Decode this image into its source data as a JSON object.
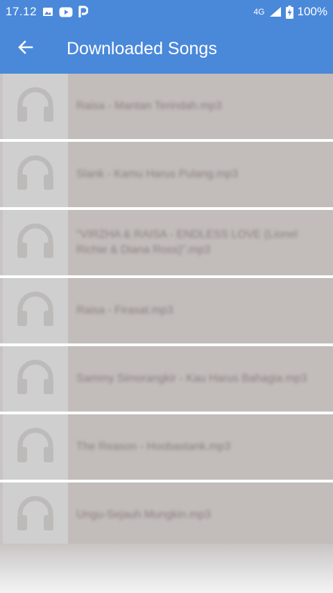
{
  "status_bar": {
    "time": "17.12",
    "network": "4G",
    "battery": "100%",
    "icons": [
      "image-icon",
      "youtube-icon",
      "p-app-icon",
      "signal-icon",
      "battery-charging-icon"
    ]
  },
  "app_bar": {
    "title": "Downloaded Songs",
    "back_icon": "arrow-left-icon"
  },
  "songs": [
    {
      "title": "Raisa - Mantan Terindah.mp3",
      "icon": "headphones-icon"
    },
    {
      "title": "Slank - Kamu Harus Pulang.mp3",
      "icon": "headphones-icon"
    },
    {
      "title": "\"VIRZHA & RAISA - ENDLESS LOVE (Lionel Richie & Diana Ross)\".mp3",
      "icon": "headphones-icon"
    },
    {
      "title": "Raisa - Firasat.mp3",
      "icon": "headphones-icon"
    },
    {
      "title": "Sammy Simorangkir - Kau Harus Bahagia.mp3",
      "icon": "headphones-icon"
    },
    {
      "title": "The Reason - Hoobastank.mp3",
      "icon": "headphones-icon"
    },
    {
      "title": "Ungu-Sejauh Mungkin.mp3",
      "icon": "headphones-icon"
    }
  ],
  "colors": {
    "primary": "#4a88da",
    "list_item_bg": "#c2bcbb",
    "thumb_bg": "#d0cfcf",
    "divider": "#ffffff"
  }
}
